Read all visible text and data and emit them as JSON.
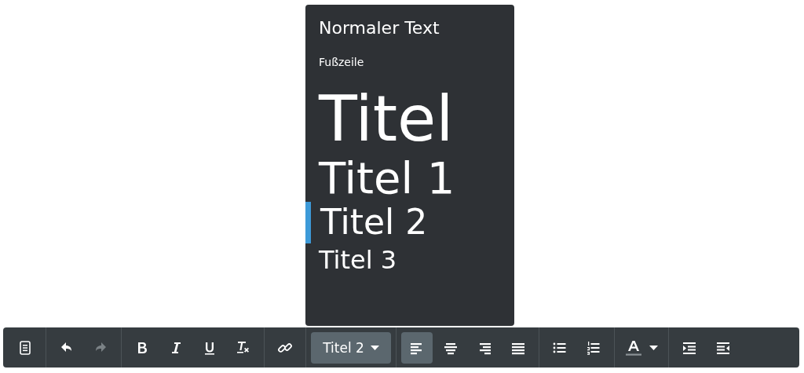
{
  "style_menu": {
    "items": [
      {
        "label": "Normaler Text",
        "kind": "normal",
        "selected": false
      },
      {
        "label": "Fußzeile",
        "kind": "footer",
        "selected": false
      },
      {
        "label": "Titel",
        "kind": "title",
        "selected": false
      },
      {
        "label": "Titel 1",
        "kind": "h1",
        "selected": false
      },
      {
        "label": "Titel 2",
        "kind": "h2",
        "selected": true
      },
      {
        "label": "Titel 3",
        "kind": "h3",
        "selected": false
      }
    ]
  },
  "toolbar": {
    "groups": [
      {
        "buttons": [
          {
            "kind": "document",
            "disabled": false,
            "selected": false
          }
        ]
      },
      {
        "buttons": [
          {
            "kind": "undo",
            "disabled": false,
            "selected": false
          },
          {
            "kind": "redo",
            "disabled": true,
            "selected": false
          }
        ]
      },
      {
        "buttons": [
          {
            "kind": "bold",
            "disabled": false,
            "selected": false
          },
          {
            "kind": "italic",
            "disabled": false,
            "selected": false
          },
          {
            "kind": "underline",
            "disabled": false,
            "selected": false
          },
          {
            "kind": "clear-format",
            "disabled": false,
            "selected": false
          }
        ]
      },
      {
        "buttons": [
          {
            "kind": "link",
            "disabled": false,
            "selected": false
          }
        ]
      },
      {
        "buttons": [
          {
            "kind": "style-dropdown",
            "label": "Titel 2",
            "disabled": false,
            "selected": true
          }
        ]
      },
      {
        "buttons": [
          {
            "kind": "align-left",
            "disabled": false,
            "selected": true
          },
          {
            "kind": "align-center",
            "disabled": false,
            "selected": false
          },
          {
            "kind": "align-right",
            "disabled": false,
            "selected": false
          },
          {
            "kind": "justify",
            "disabled": false,
            "selected": false
          }
        ]
      },
      {
        "buttons": [
          {
            "kind": "bullet-list",
            "disabled": false,
            "selected": false
          },
          {
            "kind": "numbered-list",
            "disabled": false,
            "selected": false
          }
        ]
      },
      {
        "buttons": [
          {
            "kind": "text-color",
            "disabled": false,
            "selected": false
          }
        ]
      },
      {
        "buttons": [
          {
            "kind": "indent",
            "disabled": false,
            "selected": false
          },
          {
            "kind": "outdent",
            "disabled": false,
            "selected": false
          }
        ]
      }
    ]
  }
}
